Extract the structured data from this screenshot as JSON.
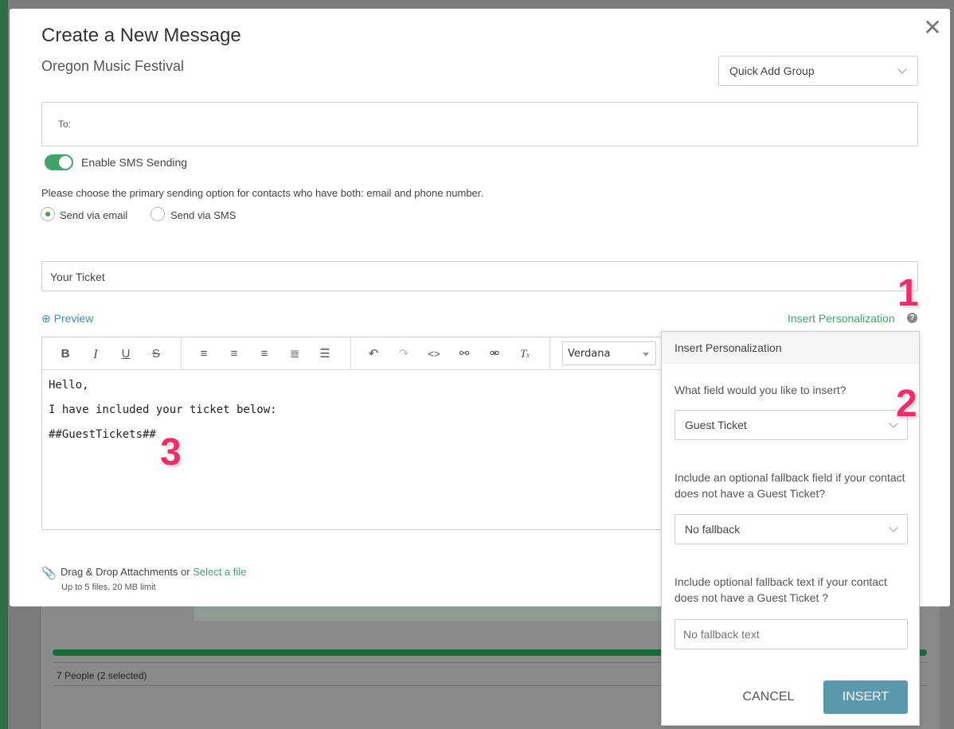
{
  "background": {
    "people_text": "7 People (2 selected)"
  },
  "modal": {
    "title": "Create a New Message",
    "subtitle": "Oregon Music Festival",
    "close_glyph": "✕",
    "quick_add": "Quick Add Group",
    "to_label": "To:",
    "sms_toggle_label": "Enable SMS Sending",
    "sms_toggle_on": true,
    "choose_text": "Please choose the primary sending option for contacts who have both: email and phone number.",
    "radio_email": "Send via email",
    "radio_sms": "Send via SMS",
    "radio_selected": "email",
    "subject": "Your Ticket",
    "preview_label": "Preview",
    "insert_personalization_label": "Insert Personalization",
    "help_glyph": "?",
    "font_name": "Verdana",
    "editor_lines": [
      "Hello,",
      "I have included your ticket below:",
      "##GuestTickets##"
    ],
    "attach_text": "Drag & Drop Attachments or ",
    "attach_link": "Select a file",
    "attach_limit": "Up to 5 files, 20 MB limit"
  },
  "personalization": {
    "header": "Insert Personalization",
    "question_field": "What field would you like to insert?",
    "field_value": "Guest Ticket",
    "question_fallback_field": "Include an optional fallback field if your contact does not have a Guest Ticket?",
    "fallback_field_value": "No fallback",
    "question_fallback_text": "Include optional fallback text if your contact does not have a Guest Ticket ?",
    "fallback_text_placeholder": "No fallback text",
    "cancel_label": "CANCEL",
    "insert_label": "INSERT"
  },
  "annotations": [
    "1",
    "2",
    "3"
  ],
  "colors": {
    "accent_green": "#3fa46a",
    "link_blue": "#3d8fa8",
    "insert_button": "#5b97ad",
    "annotation": "#ef2d6d"
  }
}
